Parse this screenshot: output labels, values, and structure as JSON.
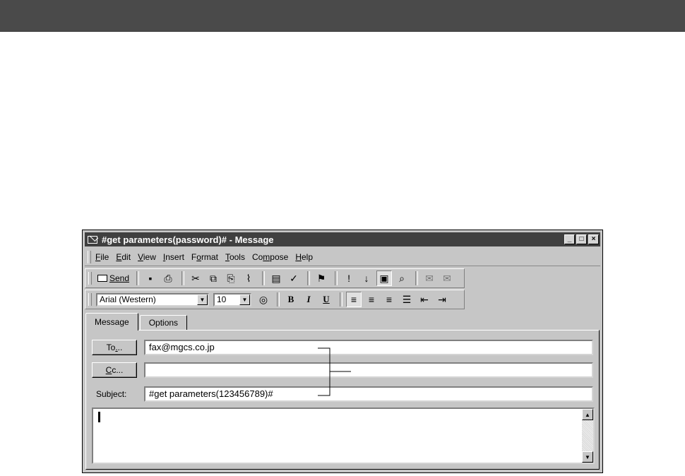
{
  "window": {
    "title": "#get parameters(password)# - Message",
    "buttons": [
      "minimize",
      "maximize",
      "close"
    ]
  },
  "menu": [
    {
      "label": "File",
      "key": "F"
    },
    {
      "label": "Edit",
      "key": "E"
    },
    {
      "label": "View",
      "key": "V"
    },
    {
      "label": "Insert",
      "key": "I"
    },
    {
      "label": "Format",
      "key": "o"
    },
    {
      "label": "Tools",
      "key": "T"
    },
    {
      "label": "Compose",
      "key": "m"
    },
    {
      "label": "Help",
      "key": "H"
    }
  ],
  "toolbar": {
    "send_label": "Send",
    "icons": [
      "save-icon",
      "print-icon",
      "cut-icon",
      "copy-icon",
      "paste-icon",
      "attach-icon",
      "address-book-icon",
      "check-names-icon",
      "flag-icon",
      "high-priority-icon",
      "low-priority-icon",
      "properties-icon",
      "find-icon",
      "sign-icon",
      "encrypt-icon"
    ]
  },
  "format_bar": {
    "font": "Arial (Western)",
    "size": "10",
    "bold": "B",
    "italic": "I",
    "underline": "U"
  },
  "tabs": [
    "Message",
    "Options"
  ],
  "fields": {
    "to_label": "To...",
    "to_value": "fax@mgcs.co.jp",
    "cc_label": "Cc...",
    "cc_value": "",
    "subject_label": "Subject:",
    "subject_value": "#get parameters(123456789)#"
  },
  "body_text": ""
}
